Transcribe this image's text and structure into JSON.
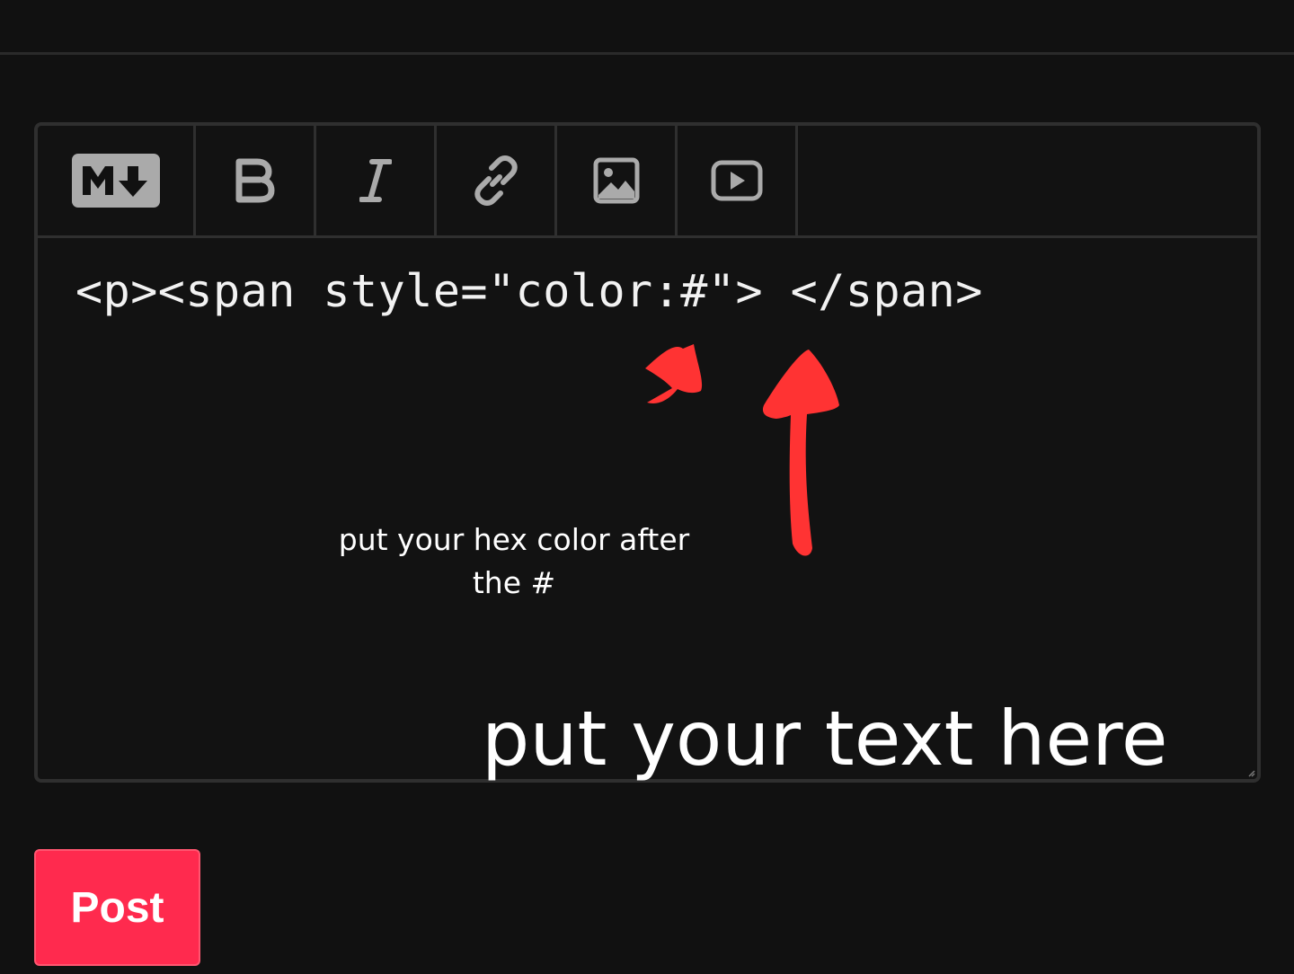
{
  "editor": {
    "toolbar": {
      "items": [
        {
          "icon": "markdown-icon",
          "label": "M"
        },
        {
          "icon": "bold-icon",
          "label": "B"
        },
        {
          "icon": "italic-icon",
          "label": "I"
        },
        {
          "icon": "link-icon"
        },
        {
          "icon": "image-icon"
        },
        {
          "icon": "video-icon"
        }
      ]
    },
    "content": "<p><span style=\"color:#\"> </span>"
  },
  "annotations": {
    "hex_hint": "put your hex color after the #",
    "text_hint": "put your text here",
    "arrow_color": "#ff3333"
  },
  "actions": {
    "post_label": "Post",
    "post_color": "#ff2a4e"
  },
  "theme": {
    "background": "#111111",
    "border": "#2f2f2f",
    "icon_color": "#aaaaaa"
  }
}
